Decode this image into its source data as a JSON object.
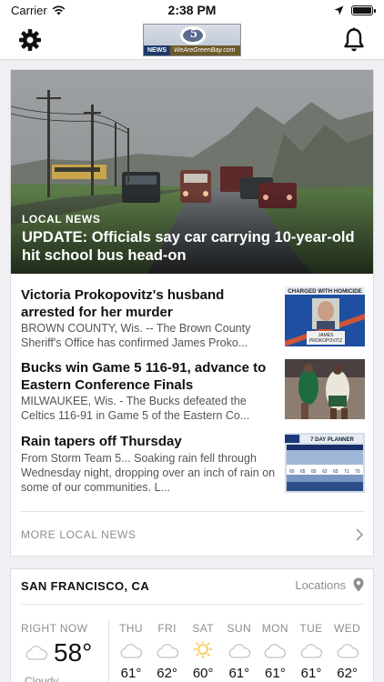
{
  "status_bar": {
    "carrier": "Carrier",
    "time": "2:38 PM"
  },
  "header": {
    "logo_channel": "5",
    "logo_news": "NEWS",
    "logo_site": "WeAreGreenBay.com",
    "logo_local": "LOCAL"
  },
  "hero": {
    "category": "LOCAL NEWS",
    "headline": "UPDATE: Officials say car carrying 10-year-old hit school bus head-on"
  },
  "stories": [
    {
      "title": "Victoria Prokopovitz's husband arrested for her murder",
      "summary": "BROWN COUNTY, Wis. -- The Brown County Sheriff's Office has confirmed James Proko...",
      "thumb_banner": "CHARGED WITH HOMICIDE",
      "thumb_caption": "JAMES PROKOPOVITZ"
    },
    {
      "title": "Bucks win Game 5 116-91, advance to Eastern Conference Finals",
      "summary": "MILWAUKEE, Wis. - The Bucks defeated the Celtics 116-91 in Game 5 of the Eastern Co..."
    },
    {
      "title": "Rain tapers off Thursday",
      "summary": "From Storm Team 5... Soaking rain fell through Wednesday night, dropping over an inch of rain on some of our communities. L...",
      "thumb_banner": "7 DAY PLANNER"
    }
  ],
  "more_link": "MORE LOCAL NEWS",
  "weather": {
    "location": "SAN FRANCISCO, CA",
    "locations_label": "Locations",
    "now": {
      "label": "RIGHT NOW",
      "temp": "58°",
      "condition": "Cloudy",
      "icon": "cloud-icon"
    },
    "days": [
      {
        "label": "THU",
        "temp": "61°",
        "icon": "cloud-icon"
      },
      {
        "label": "FRI",
        "temp": "62°",
        "icon": "cloud-icon"
      },
      {
        "label": "SAT",
        "temp": "60°",
        "icon": "sun-icon"
      },
      {
        "label": "SUN",
        "temp": "61°",
        "icon": "cloud-icon"
      },
      {
        "label": "MON",
        "temp": "61°",
        "icon": "cloud-icon"
      },
      {
        "label": "TUE",
        "temp": "61°",
        "icon": "cloud-icon"
      },
      {
        "label": "WED",
        "temp": "62°",
        "icon": "cloud-icon"
      }
    ]
  },
  "colors": {
    "accent_sun": "#f5c842",
    "muted_text": "#8d8d93",
    "card_border": "#dcdce0"
  }
}
